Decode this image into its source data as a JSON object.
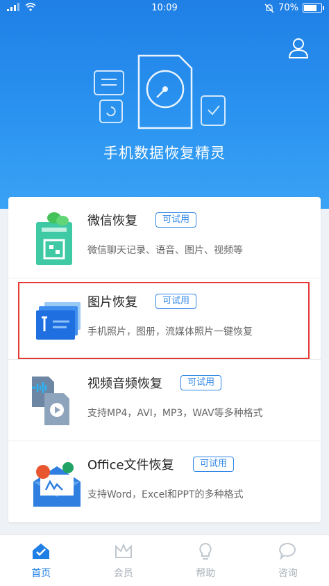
{
  "status_bar": {
    "time": "10:09",
    "battery": "70%"
  },
  "app": {
    "title": "手机数据恢复精灵"
  },
  "features": [
    {
      "title": "微信恢复",
      "badge": "可试用",
      "desc": "微信聊天记录、语音、图片、视频等",
      "icon": "wechat-doc-icon"
    },
    {
      "title": "图片恢复",
      "badge": "可试用",
      "desc": "手机照片，图册，流媒体照片一键恢复",
      "icon": "image-recovery-icon"
    },
    {
      "title": "视频音频恢复",
      "badge": "可试用",
      "desc": "支持MP4，AVI，MP3，WAV等多种格式",
      "icon": "video-audio-icon"
    },
    {
      "title": "Office文件恢复",
      "badge": "可试用",
      "desc": "支持Word，Excel和PPT的多种格式",
      "icon": "office-mail-icon"
    }
  ],
  "tabs": [
    {
      "label": "首页",
      "icon": "home-icon",
      "active": true
    },
    {
      "label": "会员",
      "icon": "crown-icon",
      "active": false
    },
    {
      "label": "帮助",
      "icon": "lightbulb-icon",
      "active": false
    },
    {
      "label": "咨询",
      "icon": "chat-bubble-icon",
      "active": false
    }
  ],
  "colors": {
    "primary": "#1f7fe5",
    "highlight_border": "#e53935",
    "tab_inactive": "#a8b0b8"
  }
}
